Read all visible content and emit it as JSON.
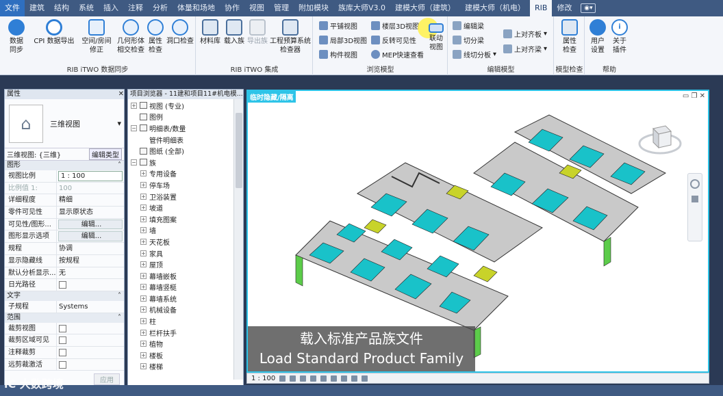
{
  "menu": {
    "tabs": [
      "文件",
      "建筑",
      "结构",
      "系统",
      "插入",
      "注释",
      "分析",
      "体量和场地",
      "协作",
      "视图",
      "管理",
      "附加模块",
      "族库大师V3.0",
      "建模大师（建筑）",
      "建模大师（机电）",
      "RIB",
      "修改"
    ],
    "active_tab": "RIB"
  },
  "ribbon": {
    "g1_label": "RIB iTWO 数据同步",
    "g1_btns": [
      "数据\n同步",
      "CPI 数据导出",
      "空间/房间\n修正",
      "几何形体\n相交检查",
      "属性\n检查",
      "洞口检查"
    ],
    "g2_label": "RIB iTWO 集成",
    "g2_btns": [
      "材料库",
      "载入族",
      "导出族",
      "工程预算系统\n检查器"
    ],
    "g3_label": "浏览模型",
    "g3_small": [
      "平铺视图",
      "局部3D视图",
      "构件视图",
      "楼层3D视图",
      "反转可见性",
      "MEP快速查看"
    ],
    "g3_big": "联动\n视图",
    "g4_label": "编辑模型",
    "g4_small": [
      "编辑梁",
      "切分梁",
      "线切分板",
      "上对齐板",
      "上对齐梁"
    ],
    "g5_label": "模型检查",
    "g5_btn": "属性\n检查",
    "g6_label": "帮助",
    "g6_btns": [
      "用户\n设置",
      "关于\n插件"
    ]
  },
  "props": {
    "title": "属性",
    "type_name": "三维视图",
    "filter": "三维视图: {三维}",
    "edit_type": "编辑类型",
    "sections": {
      "graphics": "图形",
      "text": "文字",
      "range": "范围"
    },
    "rows_graphics": [
      {
        "k": "视图比例",
        "v": "1 : 100",
        "style": "box"
      },
      {
        "k": "比例值 1:",
        "v": "100",
        "style": "grey"
      },
      {
        "k": "详细程度",
        "v": "精细",
        "style": ""
      },
      {
        "k": "零件可见性",
        "v": "显示原状态",
        "style": ""
      },
      {
        "k": "可见性/图形...",
        "v": "编辑...",
        "style": "btn"
      },
      {
        "k": "图形显示选项",
        "v": "编辑...",
        "style": "btn"
      },
      {
        "k": "规程",
        "v": "协调",
        "style": ""
      },
      {
        "k": "显示隐藏线",
        "v": "按规程",
        "style": ""
      },
      {
        "k": "默认分析显示...",
        "v": "无",
        "style": ""
      },
      {
        "k": "日光路径",
        "v": "",
        "style": "chk"
      }
    ],
    "rows_text": [
      {
        "k": "子规程",
        "v": "Systems",
        "style": ""
      }
    ],
    "rows_range": [
      {
        "k": "裁剪视图",
        "v": "",
        "style": "chk"
      },
      {
        "k": "裁剪区域可见",
        "v": "",
        "style": "chk"
      },
      {
        "k": "注释裁剪",
        "v": "",
        "style": "chk"
      },
      {
        "k": "远剪裁激活",
        "v": "",
        "style": "chk"
      }
    ],
    "apply": "应用"
  },
  "browser": {
    "title": "项目浏览器 - 11建和项目11#机电模...",
    "items": [
      {
        "t": "视图 (专业)",
        "lvl": 0,
        "plus": "⊞",
        "ico": true
      },
      {
        "t": "图例",
        "lvl": 0,
        "plus": "",
        "ico": true
      },
      {
        "t": "明细表/数量",
        "lvl": 0,
        "plus": "⊟",
        "ico": true
      },
      {
        "t": "管件明细表",
        "lvl": 1,
        "plus": "",
        "ico": false
      },
      {
        "t": "图纸 (全部)",
        "lvl": 0,
        "plus": "",
        "ico": true
      },
      {
        "t": "族",
        "lvl": 0,
        "plus": "⊟",
        "ico": true
      },
      {
        "t": "专用设备",
        "lvl": 1,
        "plus": "⊞",
        "ico": false
      },
      {
        "t": "停车场",
        "lvl": 1,
        "plus": "⊞",
        "ico": false
      },
      {
        "t": "卫浴装置",
        "lvl": 1,
        "plus": "⊞",
        "ico": false
      },
      {
        "t": "坡道",
        "lvl": 1,
        "plus": "⊞",
        "ico": false
      },
      {
        "t": "填充图案",
        "lvl": 1,
        "plus": "⊞",
        "ico": false
      },
      {
        "t": "墙",
        "lvl": 1,
        "plus": "⊞",
        "ico": false
      },
      {
        "t": "天花板",
        "lvl": 1,
        "plus": "⊞",
        "ico": false
      },
      {
        "t": "家具",
        "lvl": 1,
        "plus": "⊞",
        "ico": false
      },
      {
        "t": "屋顶",
        "lvl": 1,
        "plus": "⊞",
        "ico": false
      },
      {
        "t": "幕墙嵌板",
        "lvl": 1,
        "plus": "⊞",
        "ico": false
      },
      {
        "t": "幕墙竖梃",
        "lvl": 1,
        "plus": "⊞",
        "ico": false
      },
      {
        "t": "幕墙系统",
        "lvl": 1,
        "plus": "⊞",
        "ico": false
      },
      {
        "t": "机械设备",
        "lvl": 1,
        "plus": "⊞",
        "ico": false
      },
      {
        "t": "柱",
        "lvl": 1,
        "plus": "⊞",
        "ico": false
      },
      {
        "t": "栏杆扶手",
        "lvl": 1,
        "plus": "⊞",
        "ico": false
      },
      {
        "t": "植物",
        "lvl": 1,
        "plus": "⊞",
        "ico": false
      },
      {
        "t": "楼板",
        "lvl": 1,
        "plus": "⊞",
        "ico": false
      },
      {
        "t": "楼梯",
        "lvl": 1,
        "plus": "⊞",
        "ico": false
      }
    ]
  },
  "view": {
    "tag": "临时隐藏/隔离",
    "scale": "1 : 100"
  },
  "subtitle": {
    "zh": "载入标准产品族文件",
    "en": "Load Standard Product Family"
  },
  "watermark": "大数跨境"
}
